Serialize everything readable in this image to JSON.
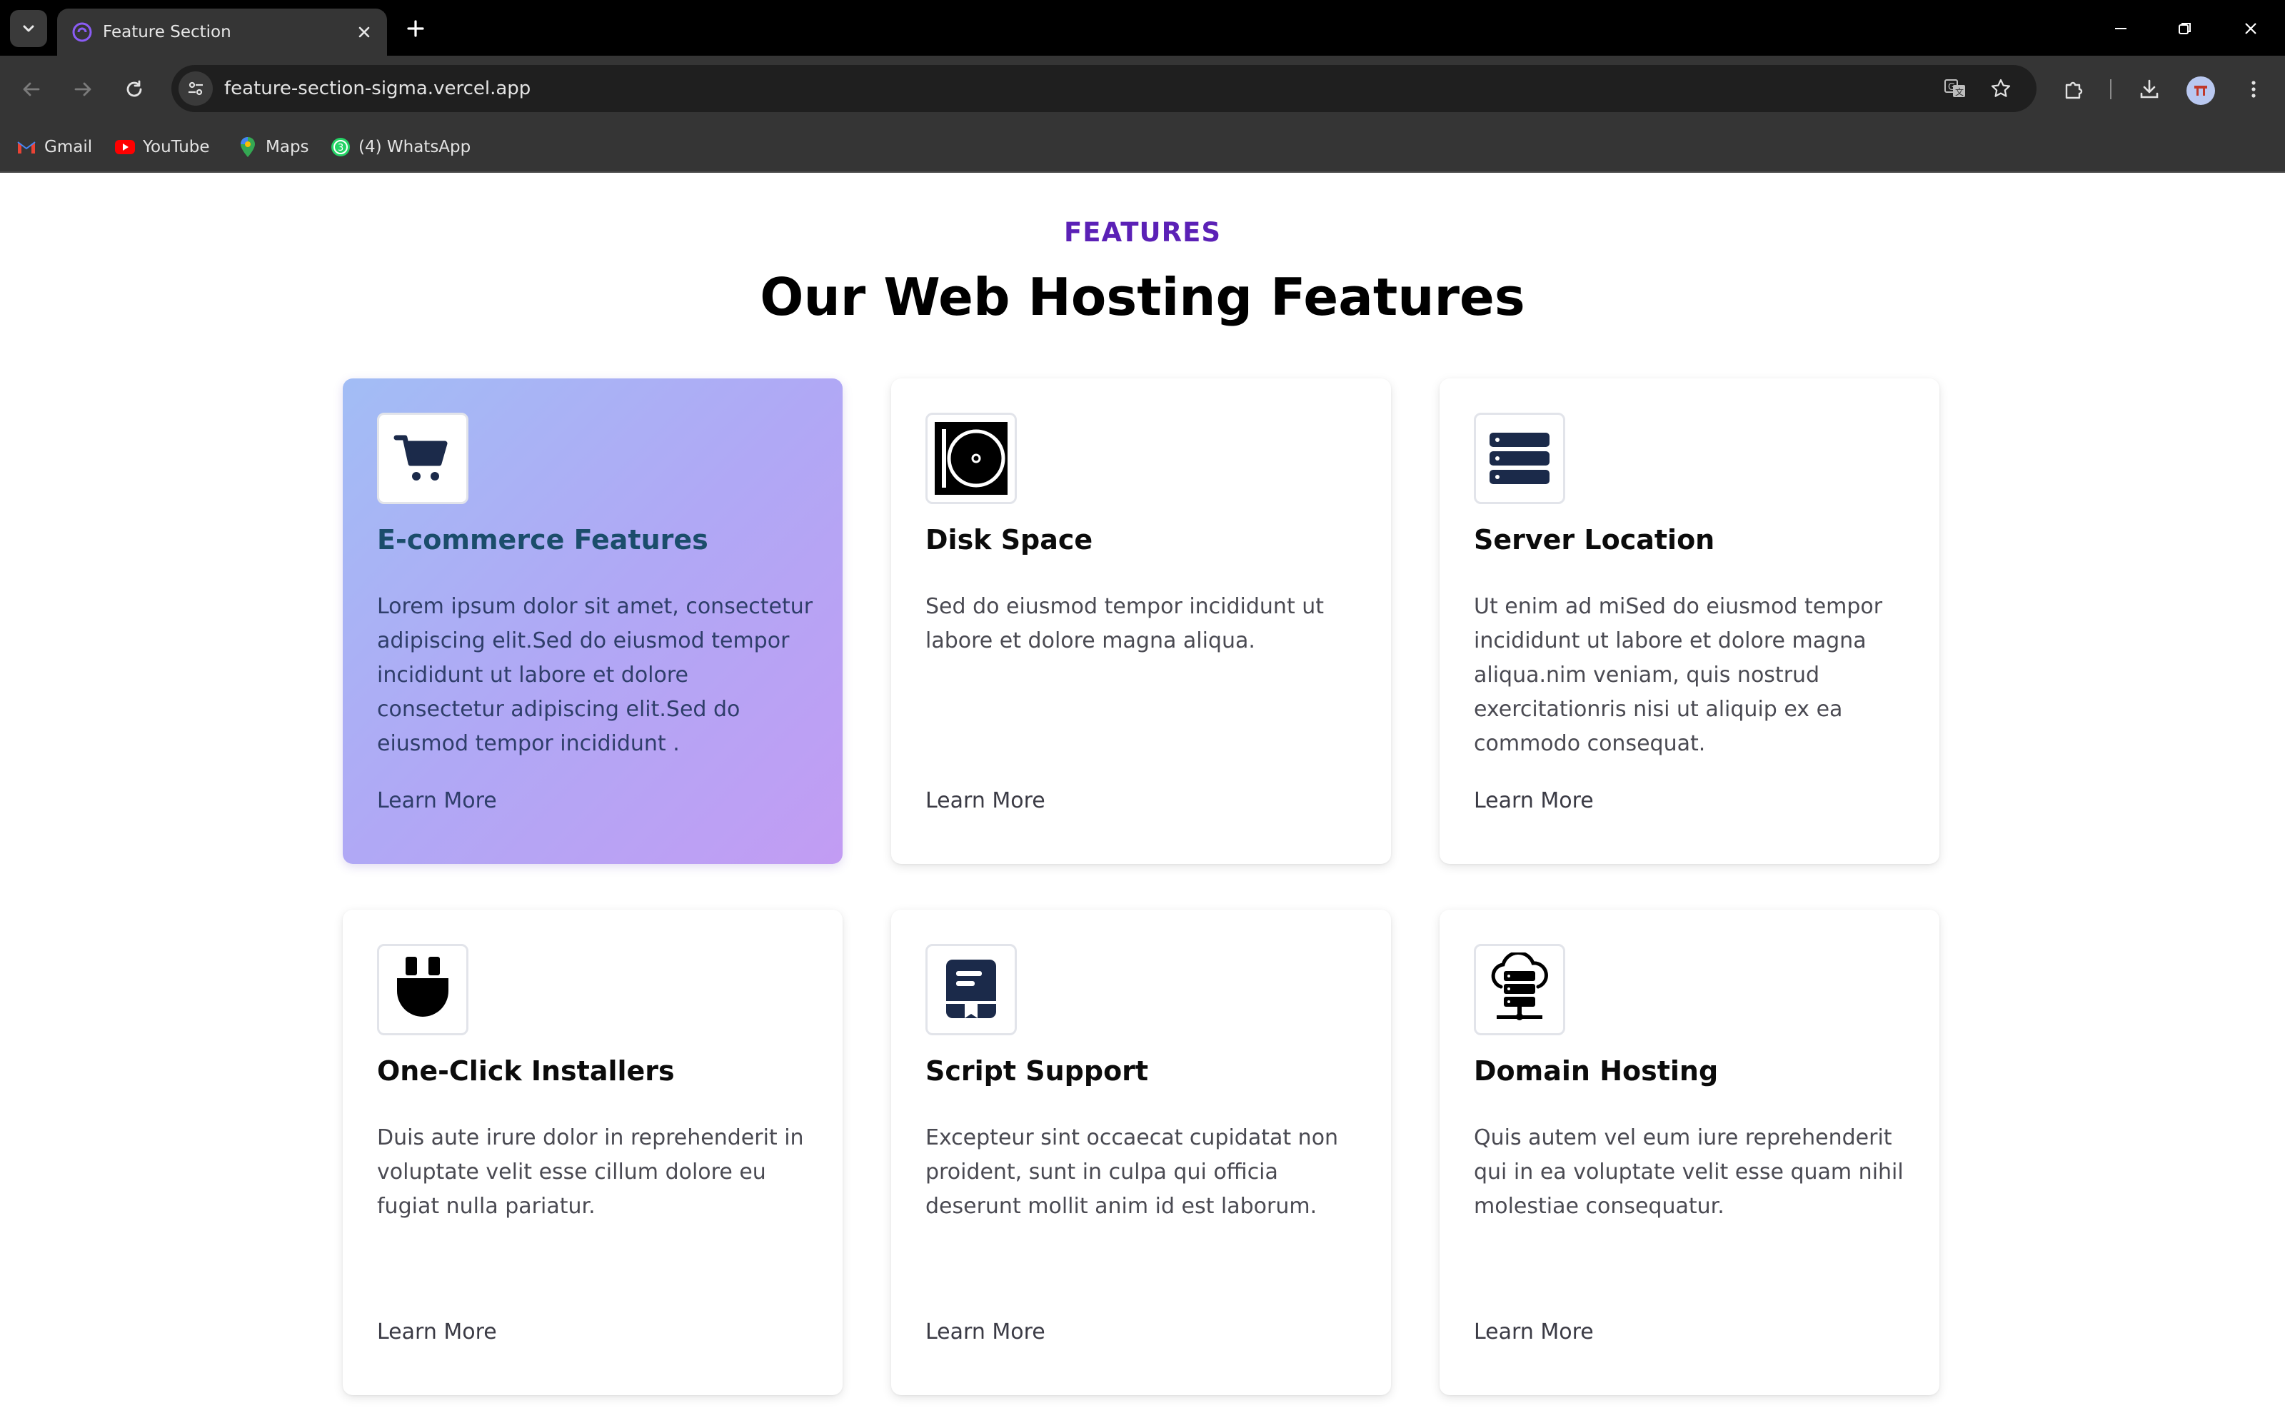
{
  "browser": {
    "tab_title": "Feature Section",
    "url": "feature-section-sigma.vercel.app",
    "bookmarks": [
      {
        "label": "Gmail",
        "icon": "gmail-icon"
      },
      {
        "label": "YouTube",
        "icon": "youtube-icon"
      },
      {
        "label": "Maps",
        "icon": "maps-icon"
      },
      {
        "label": "(4) WhatsApp",
        "icon": "whatsapp-icon"
      }
    ],
    "colors": {
      "tabstrip": "#000000",
      "toolbar": "#353535",
      "omnibox": "#1f1f1f"
    }
  },
  "section": {
    "eyebrow": "FEATURES",
    "heading": "Our Web Hosting Features",
    "accent_color": "#5b21b6"
  },
  "cards": [
    {
      "icon": "shopping-cart-icon",
      "title": "E-commerce Features",
      "description": "Lorem ipsum dolor sit amet, consectetur adipiscing elit.Sed do eiusmod tempor incididunt ut labore et dolore consectetur adipiscing elit.Sed do eiusmod tempor incididunt .",
      "link": "Learn More",
      "active": true
    },
    {
      "icon": "disk-icon",
      "title": "Disk Space",
      "description": "Sed do eiusmod tempor incididunt ut labore et dolore magna aliqua.",
      "link": "Learn More",
      "active": false
    },
    {
      "icon": "server-stack-icon",
      "title": "Server Location",
      "description": "Ut enim ad miSed do eiusmod tempor incididunt ut labore et dolore magna aliqua.nim veniam, quis nostrud exercitationris nisi ut aliquip ex ea commodo consequat.",
      "link": "Learn More",
      "active": false
    },
    {
      "icon": "plug-icon",
      "title": "One-Click Installers",
      "description": "Duis aute irure dolor in reprehenderit in voluptate velit esse cillum dolore eu fugiat nulla pariatur.",
      "link": "Learn More",
      "active": false
    },
    {
      "icon": "script-book-icon",
      "title": "Script Support",
      "description": "Excepteur sint occaecat cupidatat non proident, sunt in culpa qui officia deserunt mollit anim id est laborum.",
      "link": "Learn More",
      "active": false
    },
    {
      "icon": "cloud-server-icon",
      "title": "Domain Hosting",
      "description": "Quis autem vel eum iure reprehenderit qui in ea voluptate velit esse quam nihil molestiae consequatur.",
      "link": "Learn More",
      "active": false
    }
  ]
}
